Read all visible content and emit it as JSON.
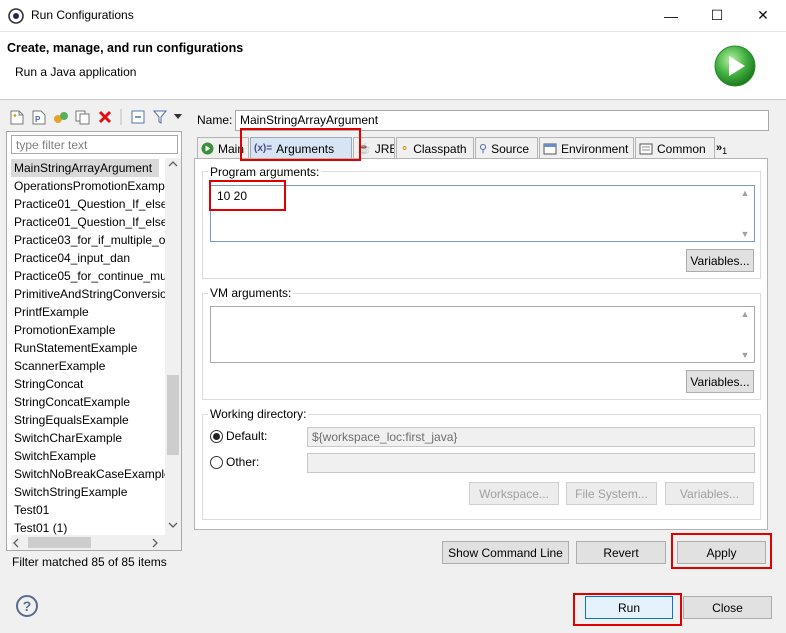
{
  "window": {
    "title": "Run Configurations",
    "minimize": "—",
    "maximize": "☐",
    "close": "✕"
  },
  "header": {
    "title": "Create, manage, and run configurations",
    "subtitle": "Run a Java application"
  },
  "sidebar": {
    "filter_placeholder": "type filter text",
    "items": [
      "MainStringArrayArgument",
      "OperationsPromotionExamp",
      "Practice01_Question_If_else_",
      "Practice01_Question_If_else_",
      "Practice03_for_if_multiple_o",
      "Practice04_input_dan",
      "Practice05_for_continue_mu",
      "PrimitiveAndStringConversio",
      "PrintfExample",
      "PromotionExample",
      "RunStatementExample",
      "ScannerExample",
      "StringConcat",
      "StringConcatExample",
      "StringEqualsExample",
      "SwitchCharExample",
      "SwitchExample",
      "SwitchNoBreakCaseExample",
      "SwitchStringExample",
      "Test01",
      "Test01 (1)"
    ],
    "filter_status": "Filter matched 85 of 85 items"
  },
  "config": {
    "name_label": "Name:",
    "name_value": "MainStringArrayArgument",
    "tabs": [
      {
        "label": "Main",
        "icon": "main-icon"
      },
      {
        "label": "Arguments",
        "icon": "arguments-icon"
      },
      {
        "label": "JRE",
        "icon": "jre-icon"
      },
      {
        "label": "Classpath",
        "icon": "classpath-icon"
      },
      {
        "label": "Source",
        "icon": "source-icon"
      },
      {
        "label": "Environment",
        "icon": "environment-icon"
      },
      {
        "label": "Common",
        "icon": "common-icon"
      }
    ],
    "overflow_count": "1",
    "program_args_label": "Program arguments:",
    "program_args_value": "10 20",
    "vm_args_label": "VM arguments:",
    "vm_args_value": "",
    "variables_label": "Variables...",
    "working_dir_label": "Working directory:",
    "default_label": "Default:",
    "default_value": "${workspace_loc:first_java}",
    "other_label": "Other:",
    "other_value": "",
    "workspace_btn": "Workspace...",
    "filesystem_btn": "File System...",
    "variables_btn": "Variables..."
  },
  "actions": {
    "show_cmd": "Show Command Line",
    "revert": "Revert",
    "apply": "Apply",
    "run": "Run",
    "close": "Close",
    "help": "?"
  },
  "colors": {
    "highlight": "#e00000",
    "active_tab": "#d6e4f3",
    "run_logo": "#3fae3f"
  }
}
